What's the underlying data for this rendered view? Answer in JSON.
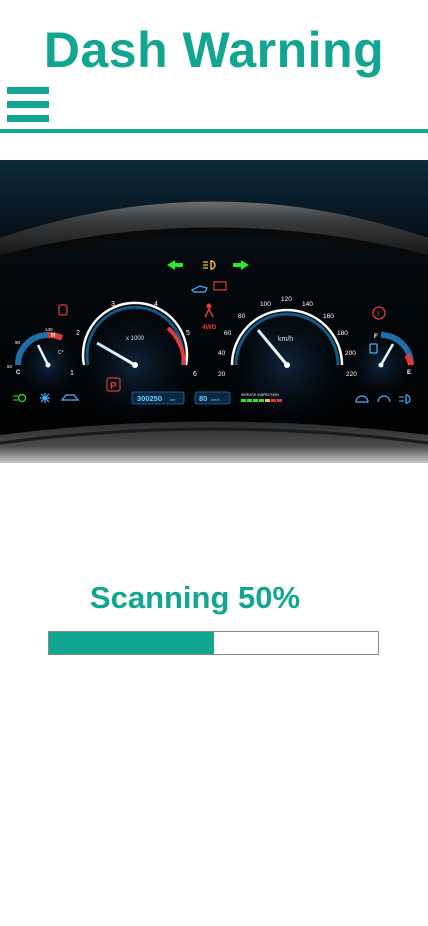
{
  "header": {
    "title": "Dash Warning",
    "menu_icon": "hamburger-menu-icon",
    "accent_color": "#12a592"
  },
  "dashboard": {
    "temp_gauge": {
      "hot_label": "H",
      "cold_label": "C",
      "ticks": [
        "140",
        "90",
        "50"
      ],
      "unit": "C°"
    },
    "tachometer": {
      "ticks": [
        "1",
        "2",
        "3",
        "4",
        "5",
        "6"
      ],
      "unit": "x 1000"
    },
    "speedometer": {
      "ticks": [
        "20",
        "40",
        "60",
        "80",
        "100",
        "120",
        "140",
        "160",
        "180",
        "200",
        "220"
      ],
      "unit": "km/h"
    },
    "fuel_gauge": {
      "full_label": "F",
      "empty_label": "E"
    },
    "odometer": {
      "value": "300250",
      "unit": "km"
    },
    "speed_display": {
      "value": "80",
      "unit": "km/h"
    },
    "service_label": "SERVICE INSPECTION",
    "gear_indicator": "P",
    "drive_mode": "4WD",
    "icons": [
      "turn-left-arrow-icon",
      "headlight-icon",
      "turn-right-arrow-icon",
      "oil-pressure-icon",
      "battery-icon",
      "seatbelt-icon",
      "airbag-icon",
      "brake-warning-icon",
      "fuel-pump-icon",
      "fog-light-icon",
      "defrost-icon",
      "car-door-icon",
      "wiper-icon",
      "washer-icon",
      "high-beam-icon"
    ]
  },
  "scan": {
    "label": "Scanning 50%",
    "progress": 0.5
  }
}
